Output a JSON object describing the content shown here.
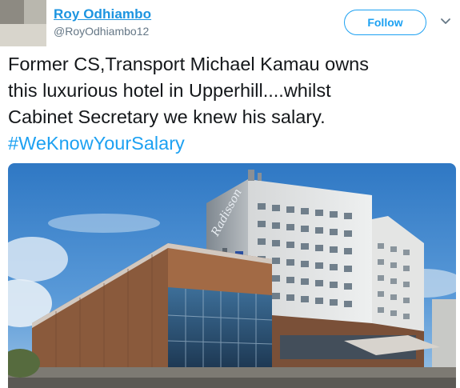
{
  "tweet": {
    "display_name": "Roy Odhiambo",
    "handle": "@RoyOdhiambo12",
    "follow_label": "Follow",
    "text_lines": [
      "Former CS,Transport Michael Kamau owns",
      "this luxurious hotel in Upperhill....whilst",
      "Cabinet Secretary we knew his salary."
    ],
    "hashtag": "#WeKnowYourSalary",
    "image_sign_text": "Radisson"
  },
  "colors": {
    "link_blue": "#1da1f2",
    "name_blue": "#1c94e0",
    "text": "#14171a",
    "muted": "#657786"
  },
  "icons": {
    "avatar": "avatar-image",
    "caret": "chevron-down-icon"
  }
}
